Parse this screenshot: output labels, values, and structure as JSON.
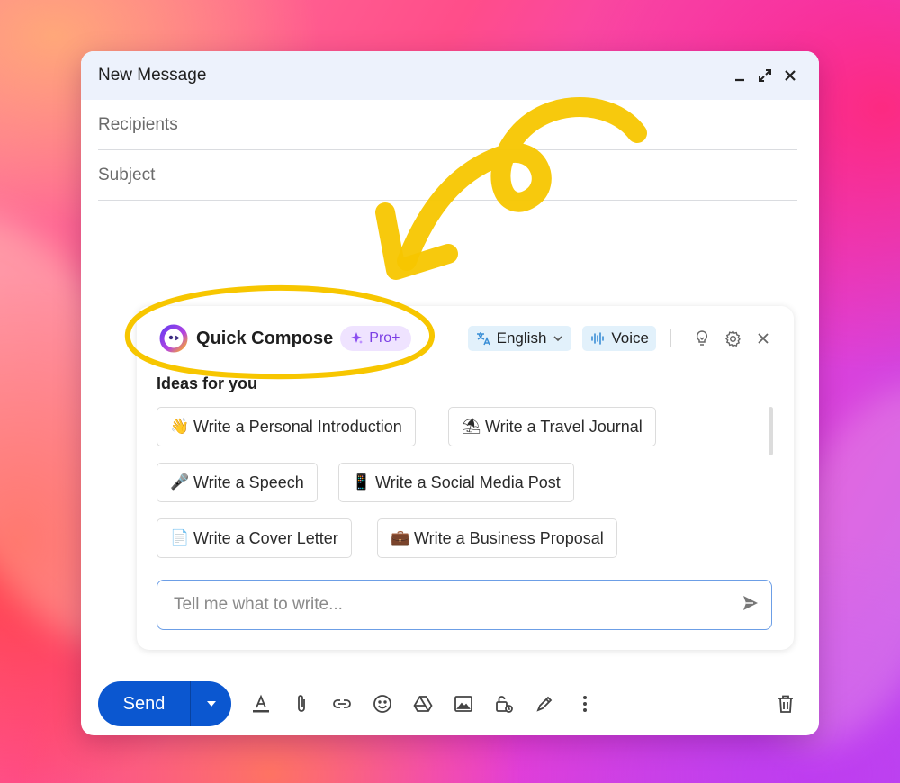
{
  "window": {
    "title": "New Message",
    "controls": [
      "minimize-icon",
      "expand-icon",
      "close-icon"
    ]
  },
  "fields": {
    "recipients_placeholder": "Recipients",
    "subject_placeholder": "Subject"
  },
  "quick_compose": {
    "name": "Quick Compose",
    "badge": "Pro+",
    "language": "English",
    "voice": "Voice",
    "ideas_title": "Ideas for you",
    "ideas": [
      {
        "icon": "👋",
        "label": "Write a Personal Introduction"
      },
      {
        "icon": "⛱",
        "label": "Write a Travel Journal"
      },
      {
        "icon": "🎤",
        "label": "Write a Speech"
      },
      {
        "icon": "📱",
        "label": "Write a Social Media Post"
      },
      {
        "icon": "📄",
        "label": "Write a Cover Letter"
      },
      {
        "icon": "💼",
        "label": "Write a Business Proposal"
      }
    ],
    "prompt_placeholder": "Tell me what to write..."
  },
  "toolbar": {
    "send_label": "Send"
  },
  "colors": {
    "accent": "#0b57d0",
    "highlight_stroke": "#f7c600",
    "pro_badge": "#7b3fe4"
  }
}
